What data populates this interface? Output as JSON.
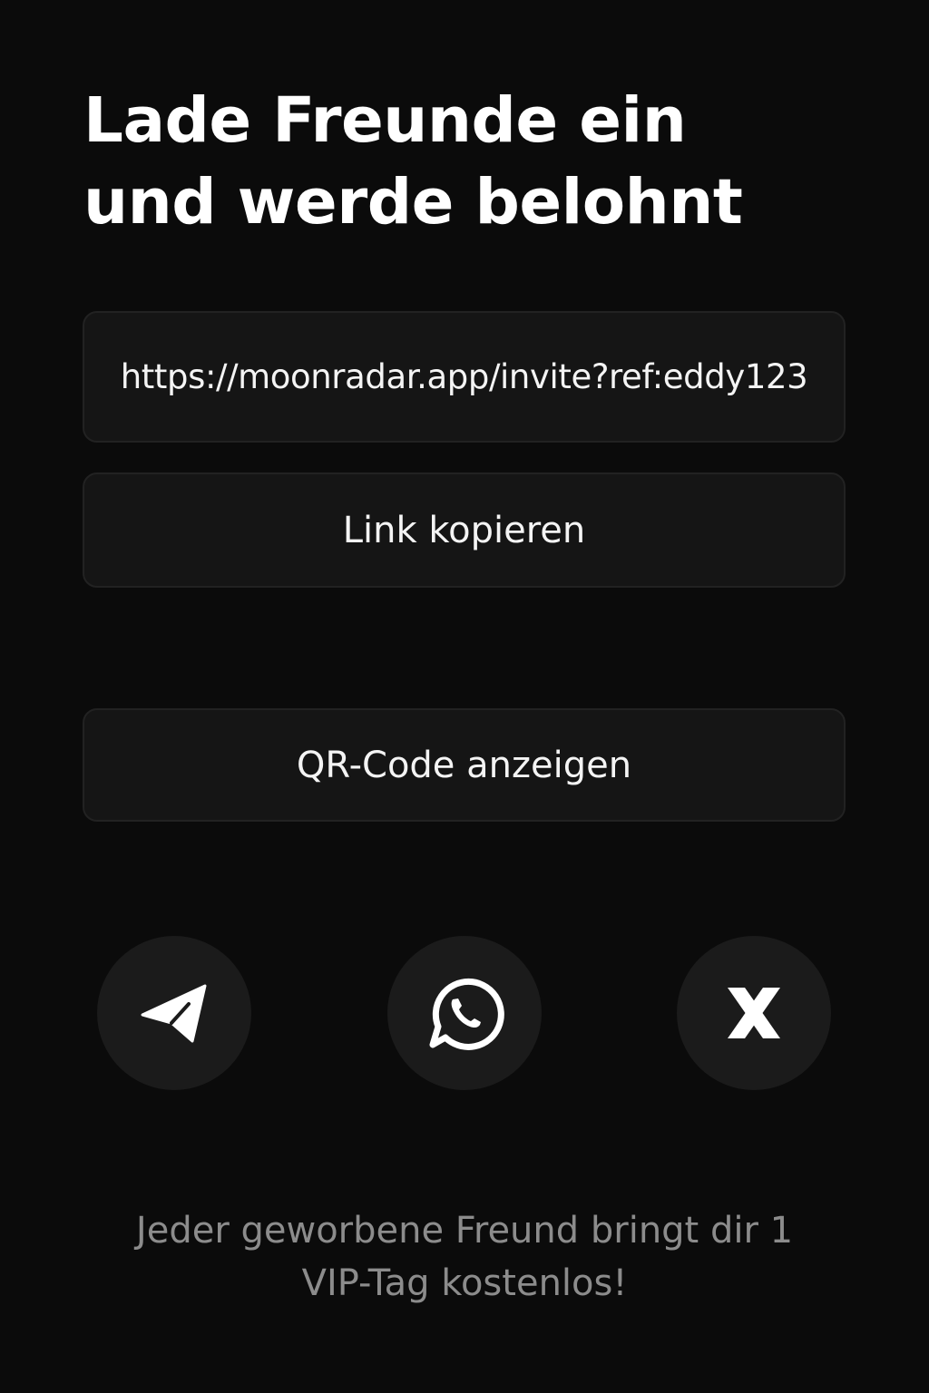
{
  "header": {
    "title_line1": "Lade Freunde ein",
    "title_line2": "und werde belohnt"
  },
  "invite": {
    "link_value": "https://moonradar.app/invite?ref:eddy123",
    "copy_label": "Link kopieren",
    "qr_label": "QR-Code anzeigen"
  },
  "share": {
    "icons": [
      "telegram-icon",
      "whatsapp-icon",
      "x-icon"
    ],
    "circle_color": "#1b1b1b",
    "icon_color": "#ffffff"
  },
  "footer": {
    "line1": "Jeder geworbene Freund bringt dir 1",
    "line2": "VIP-Tag kostenlos!"
  },
  "colors": {
    "background": "#0b0b0b",
    "surface": "#151515",
    "text": "#ffffff",
    "muted_text": "#8c8c8c"
  }
}
